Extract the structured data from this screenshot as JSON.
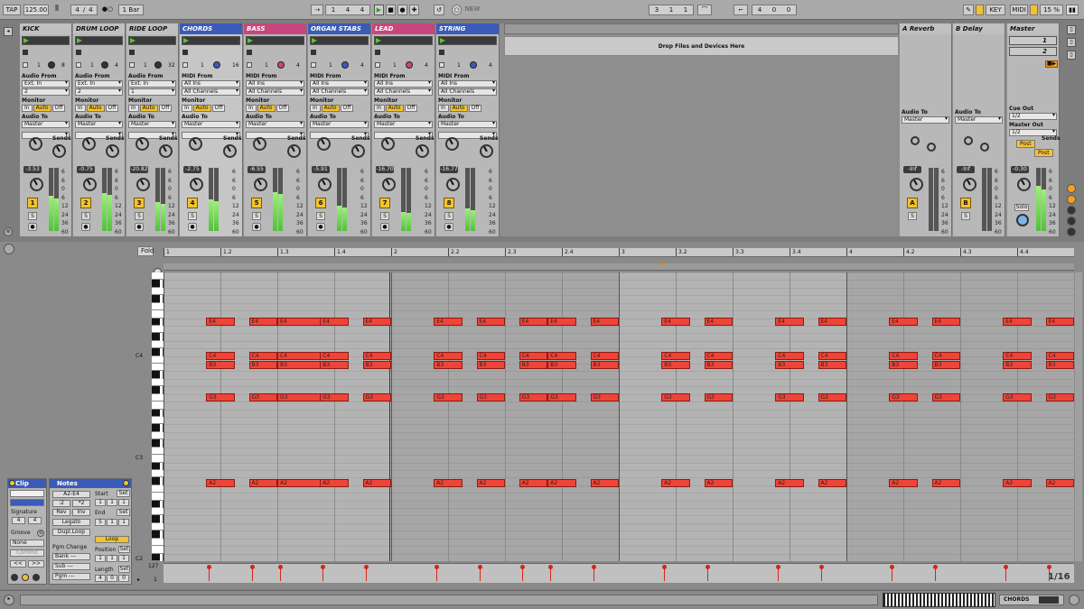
{
  "transport": {
    "tap": "TAP",
    "tempo": "125.00",
    "signature_num": "4",
    "signature_den": "4",
    "quantize": "1 Bar",
    "arrangement_position": [
      "1",
      "4",
      "4"
    ],
    "new_label": "NEW",
    "loop_start": [
      "3",
      "1",
      "1"
    ],
    "loop_length": [
      "4",
      "0",
      "0"
    ],
    "key_label": "KEY",
    "midi_label": "MIDI",
    "cpu": "15 %"
  },
  "tracks": [
    {
      "name": "KICK",
      "color": "#c0c0c0",
      "type": "audio",
      "routing_from_label": "Audio From",
      "from": "Ext. In",
      "channel": "2",
      "slot_num": "1",
      "slot_num2": "8",
      "vol": "-3.53",
      "num": "1",
      "meter": 0.55
    },
    {
      "name": "DRUM LOOP",
      "color": "#c0c0c0",
      "type": "audio",
      "routing_from_label": "Audio From",
      "from": "Ext. In",
      "channel": "2",
      "slot_num": "1",
      "slot_num2": "4",
      "vol": "-0.75",
      "num": "2",
      "meter": 0.6
    },
    {
      "name": "RIDE LOOP",
      "color": "#c0c0c0",
      "type": "audio",
      "routing_from_label": "Audio From",
      "from": "Ext. In",
      "channel": "1",
      "slot_num": "1",
      "slot_num2": "32",
      "vol": "-20.82",
      "num": "3",
      "meter": 0.45
    },
    {
      "name": "CHORDS",
      "color": "#3a5bb8",
      "type": "midi",
      "routing_from_label": "MIDI From",
      "from": "All Ins",
      "channel": "All Channels",
      "slot_num": "1",
      "slot_num2": "16",
      "vol": "-2.75",
      "num": "4",
      "meter": 0.5
    },
    {
      "name": "BASS",
      "color": "#c8467e",
      "type": "midi",
      "routing_from_label": "MIDI From",
      "from": "All Ins",
      "channel": "All Channels",
      "slot_num": "1",
      "slot_num2": "4",
      "vol": "-6.55",
      "num": "5",
      "meter": 0.62
    },
    {
      "name": "ORGAN STABS",
      "color": "#3a5bb8",
      "type": "midi",
      "routing_from_label": "MIDI From",
      "from": "All Ins",
      "channel": "All Channels",
      "slot_num": "1",
      "slot_num2": "4",
      "vol": "-5.91",
      "num": "6",
      "meter": 0.4
    },
    {
      "name": "LEAD",
      "color": "#c8467e",
      "type": "midi",
      "routing_from_label": "MIDI From",
      "from": "All Ins",
      "channel": "All Channels",
      "slot_num": "1",
      "slot_num2": "4",
      "vol": "-16.70",
      "num": "7",
      "meter": 0.3
    },
    {
      "name": "STRING",
      "color": "#3a5bb8",
      "type": "midi",
      "routing_from_label": "MIDI From",
      "from": "All Ins",
      "channel": "All Channels",
      "slot_num": "1",
      "slot_num2": "4",
      "vol": "-16.77",
      "num": "8",
      "meter": 0.35
    }
  ],
  "mixer": {
    "monitor_label": "Monitor",
    "mon_in": "In",
    "mon_auto": "Auto",
    "mon_off": "Off",
    "audio_to_label": "Audio To",
    "audio_to": "Master",
    "sends_label": "Sends",
    "send_a": "A",
    "send_b": "B",
    "solo": "S",
    "scale": [
      "6",
      "6",
      "0",
      "6",
      "12",
      "24",
      "36",
      "60"
    ],
    "drop_text": "Drop Files and Devices Here"
  },
  "returns": [
    {
      "name": "A Reverb",
      "vol": "-Inf",
      "letter": "A"
    },
    {
      "name": "B Delay",
      "vol": "-Inf",
      "letter": "B"
    }
  ],
  "master": {
    "name": "Master",
    "scene1": "1",
    "scene2": "2",
    "cue_out_label": "Cue Out",
    "cue_out": "1/2",
    "master_out_label": "Master Out",
    "master_out": "1/2",
    "post1": "Post",
    "post2": "Post",
    "vol": "-0.30",
    "solo_label": "Solo"
  },
  "clip_panel": {
    "title": "Clip",
    "signature_label": "Signature",
    "sig_num": "4",
    "sig_den": "4",
    "groove_label": "Groove",
    "groove_value": "None",
    "commit": "Commit",
    "nav_prev": "<<",
    "nav_next": ">>"
  },
  "notes_panel": {
    "title": "Notes",
    "range": "A2-E4",
    "half": ":2",
    "double": "*2",
    "rev": "Rev",
    "inv": "Inv",
    "legato": "Legato",
    "dupl_loop": "Dupl.Loop",
    "start_label": "Start",
    "end_label": "End",
    "set": "Set",
    "start": [
      "1",
      "1",
      "1"
    ],
    "end": [
      "5",
      "1",
      "1"
    ],
    "loop": "Loop",
    "position_label": "Position",
    "position": [
      "1",
      "1",
      "1"
    ],
    "length_label": "Length",
    "length": [
      "4",
      "0",
      "0"
    ],
    "pgm_change_label": "Pgm Change",
    "bank": "Bank ---",
    "sub": "Sub ---",
    "pgm": "Pgm ---"
  },
  "editor": {
    "fold": "Fold",
    "ruler": [
      "1",
      "1.2",
      "1.3",
      "1.4",
      "2",
      "2.2",
      "2.3",
      "2.4",
      "3",
      "3.2",
      "3.3",
      "3.4",
      "4",
      "4.2",
      "4.3",
      "4.4"
    ],
    "key_labels": [
      "C4",
      "C3",
      "C2"
    ],
    "vel_max": "127",
    "vel_min": "1",
    "zoom": "1/16"
  },
  "notes_grid": {
    "pitches": [
      "E4",
      "C4",
      "B3",
      "G3",
      "A2"
    ],
    "starts": [
      0.75,
      1.5,
      2.0,
      2.75,
      3.5,
      4.75,
      5.5,
      6.25,
      6.75,
      7.5,
      8.75,
      9.5,
      10.75,
      11.5,
      12.75,
      13.5,
      14.75,
      15.5
    ],
    "lengths": [
      0.5,
      0.5,
      1.0,
      0.5,
      0.5,
      0.5,
      0.5,
      0.5,
      0.5,
      0.5,
      0.5,
      0.5,
      0.5,
      0.5,
      0.5,
      0.5,
      0.5,
      0.5
    ]
  },
  "status": {
    "track_name": "CHORDS"
  }
}
